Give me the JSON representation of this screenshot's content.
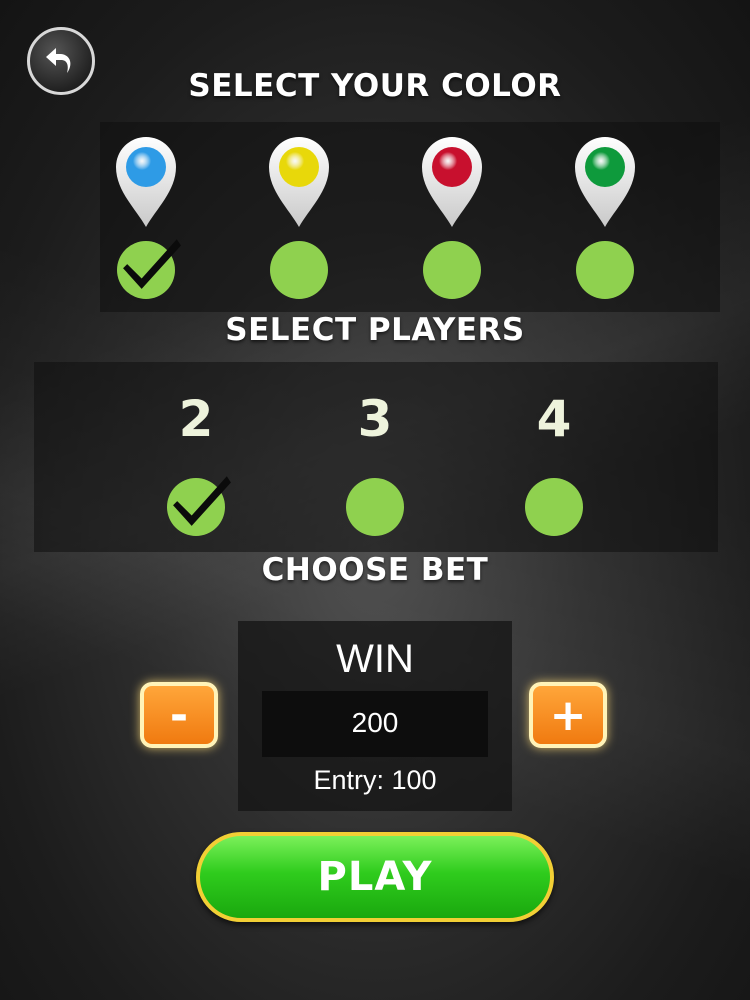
{
  "back": {
    "icon": "back-arrow-icon"
  },
  "color_section": {
    "heading": "SELECT YOUR COLOR",
    "options": [
      {
        "name": "blue",
        "color": "#2e9be6",
        "selected": true
      },
      {
        "name": "yellow",
        "color": "#e8d80a",
        "selected": false
      },
      {
        "name": "red",
        "color": "#c8102e",
        "selected": false
      },
      {
        "name": "green",
        "color": "#0e9a3c",
        "selected": false
      }
    ]
  },
  "players_section": {
    "heading": "SELECT PLAYERS",
    "options": [
      {
        "label": "2",
        "selected": true
      },
      {
        "label": "3",
        "selected": false
      },
      {
        "label": "4",
        "selected": false
      }
    ]
  },
  "bet_section": {
    "heading": "CHOOSE BET",
    "win_label": "WIN",
    "win_value": "200",
    "entry_text": "Entry: 100",
    "minus_label": "-",
    "plus_label": "+"
  },
  "play_button": {
    "label": "PLAY"
  },
  "colors": {
    "radio_green": "#8fd14f",
    "accent_orange": "#f07a10",
    "play_green": "#2fcc1d"
  }
}
